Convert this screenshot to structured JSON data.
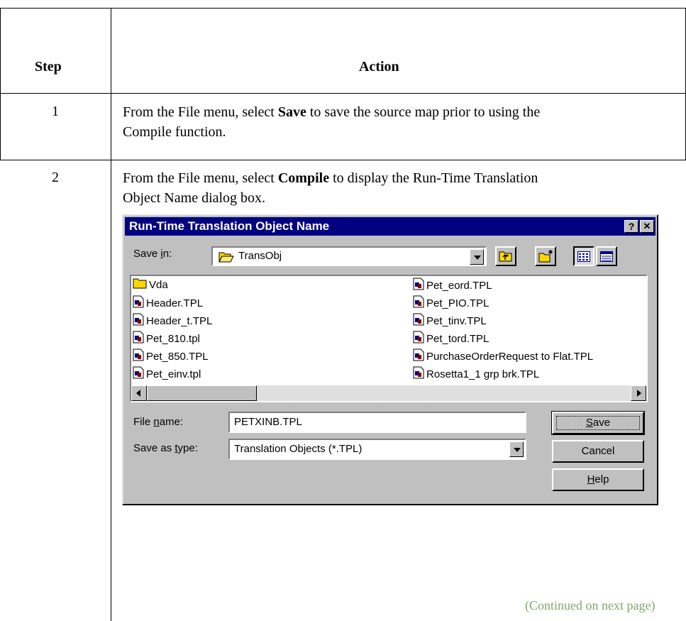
{
  "table": {
    "header_step": "Step",
    "header_action": "Action",
    "rows": [
      {
        "step": "1",
        "text_line1_pre": "From the File menu, select ",
        "text_line1_bold": "Save",
        "text_line1_post": " to save the source map prior to using the",
        "text_line2": "Compile function."
      },
      {
        "step": "2",
        "text_line1_pre": "From the File menu, select ",
        "text_line1_bold": "Compile",
        "text_line1_post": " to display the Run-Time Translation",
        "text_line2": "Object Name dialog box."
      }
    ],
    "continued": "(Continued on next page)"
  },
  "dialog": {
    "title": "Run-Time Translation Object Name",
    "help_btn": "?",
    "close_btn": "✕",
    "save_in_label_pre": "Save ",
    "save_in_label_ul": "i",
    "save_in_label_post": "n:",
    "save_in_value": "TransObj",
    "files_left": [
      "Vda",
      "Header.TPL",
      "Header_t.TPL",
      "Pet_810.tpl",
      "Pet_850.TPL",
      "Pet_einv.tpl"
    ],
    "files_right": [
      "Pet_eord.TPL",
      "Pet_PIO.TPL",
      "Pet_tinv.TPL",
      "Pet_tord.TPL",
      "PurchaseOrderRequest to Flat.TPL",
      "Rosetta1_1 grp brk.TPL"
    ],
    "file_name_label_pre": "File ",
    "file_name_label_ul": "n",
    "file_name_label_post": "ame:",
    "file_name_value": "PETXINB.TPL",
    "save_type_label_pre": "Save as ",
    "save_type_label_ul": "t",
    "save_type_label_post": "ype:",
    "save_type_value": "Translation Objects (*.TPL)",
    "save_btn_ul": "S",
    "save_btn_rest": "ave",
    "cancel_btn": "Cancel",
    "help_btn_ul": "H",
    "help_btn_rest": "elp"
  },
  "colors": {
    "titlebar": "#000080",
    "dialog_face": "#c0c0c0",
    "continued_text": "#7fa86a",
    "folder": "#ffd700"
  }
}
